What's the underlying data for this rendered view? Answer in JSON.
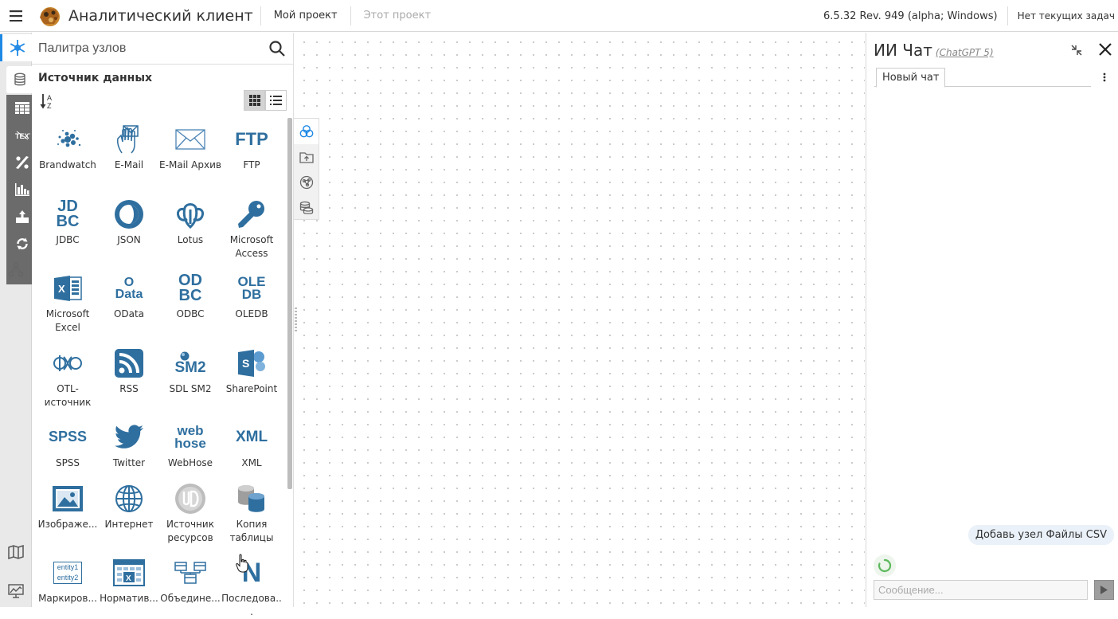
{
  "topbar": {
    "app_title": "Аналитический клиент",
    "project_link": "Мой проект",
    "this_project_link": "Этот проект",
    "version": "6.5.32 Rev. 949 (alpha; Windows)",
    "tasks": "Нет текущих задач"
  },
  "palette": {
    "search_placeholder": "Палитра узлов",
    "section_title": "Источник данных",
    "nodes": [
      {
        "label": "Brandwatch",
        "icon": "brandwatch-icon"
      },
      {
        "label": "E-Mail",
        "icon": "email-hand-icon"
      },
      {
        "label": "E-Mail Архив",
        "icon": "envelope-icon"
      },
      {
        "label": "FTP",
        "icon": "ftp-icon",
        "text": "FTP"
      },
      {
        "label": "JDBC",
        "icon": "jdbc-icon",
        "text": "JD BC"
      },
      {
        "label": "JSON",
        "icon": "json-icon"
      },
      {
        "label": "Lotus",
        "icon": "lotus-icon"
      },
      {
        "label": "Microsoft Access",
        "icon": "access-key-icon"
      },
      {
        "label": "Microsoft Excel",
        "icon": "excel-icon"
      },
      {
        "label": "OData",
        "icon": "odata-icon",
        "text": "O Data"
      },
      {
        "label": "ODBC",
        "icon": "odbc-icon",
        "text": "OD BC"
      },
      {
        "label": "OLEDB",
        "icon": "oledb-icon",
        "text": "OLE DB"
      },
      {
        "label": "OTL-источник",
        "icon": "otl-icon"
      },
      {
        "label": "RSS",
        "icon": "rss-icon"
      },
      {
        "label": "SDL SM2",
        "icon": "sm2-icon",
        "text": "SM2"
      },
      {
        "label": "SharePoint",
        "icon": "sharepoint-icon"
      },
      {
        "label": "SPSS",
        "icon": "spss-icon",
        "text": "SPSS"
      },
      {
        "label": "Twitter",
        "icon": "twitter-icon"
      },
      {
        "label": "WebHose",
        "icon": "webhose-icon",
        "text": "web hose"
      },
      {
        "label": "XML",
        "icon": "xml-icon",
        "text": "XML"
      },
      {
        "label": "Изображе...",
        "icon": "image-icon"
      },
      {
        "label": "Интернет",
        "icon": "globe-icon"
      },
      {
        "label": "Источник ресурсов",
        "icon": "resource-source-icon"
      },
      {
        "label": "Копия таблицы",
        "icon": "table-copy-icon"
      },
      {
        "label": "Маркиров...",
        "icon": "entity-icon",
        "text": "entity1 entity2"
      },
      {
        "label": "Норматив...",
        "icon": "normative-icon"
      },
      {
        "label": "Объедине...",
        "icon": "union-icon"
      },
      {
        "label": "Последова...",
        "icon": "sequence-icon",
        "text": "N"
      }
    ]
  },
  "chat": {
    "title": "ИИ Чат",
    "model": "(ChatGPT 5)",
    "tab": "Новый чат",
    "user_message": "Добавь узел Файлы CSV",
    "input_placeholder": "Сообщение..."
  },
  "colors": {
    "accent": "#1e88e5",
    "icon_blue": "#2f6f9f",
    "rail_dark": "#6b6b6b"
  }
}
